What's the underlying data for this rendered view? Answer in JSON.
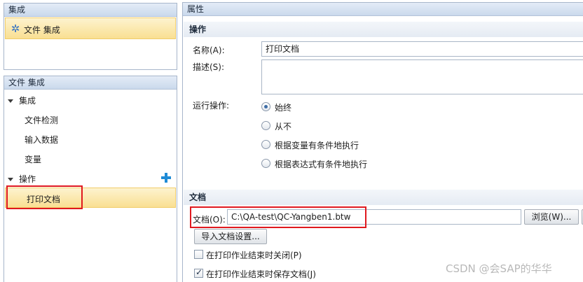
{
  "integration_panel": {
    "title": "集成",
    "item_label": "文件 集成",
    "item_icon": "gear-icon"
  },
  "tree_panel": {
    "title": "文件 集成",
    "groups": [
      {
        "label": "集成",
        "children": [
          "文件检测",
          "输入数据",
          "变量"
        ]
      },
      {
        "label": "操作",
        "children": [
          "打印文档"
        ]
      }
    ],
    "add_icon": "plus-icon",
    "selected": "打印文档"
  },
  "properties": {
    "title": "属性",
    "action_section": {
      "heading": "操作",
      "name_label": "名称(A):",
      "name_value": "打印文档",
      "description_label": "描述(S):",
      "description_value": "",
      "run_label": "运行操作:",
      "run_options": [
        "始终",
        "从不",
        "根据变量有条件地执行",
        "根据表达式有条件地执行"
      ],
      "run_selected": "始终"
    },
    "document_section": {
      "heading": "文档",
      "doc_label": "文档(O):",
      "doc_value": "C:\\QA-test\\QC-Yangben1.btw",
      "browse_button": "浏览(W)...",
      "import_button": "导入文档设置...",
      "close_after_print": {
        "label": "在打印作业结束时关闭(P)",
        "checked": false
      },
      "save_after_print": {
        "label": "在打印作业结束时保存文档(J)",
        "checked": true
      }
    }
  },
  "watermark": "CSDN @会SAP的华华",
  "colors": {
    "highlight": "#e0191f",
    "selection": "#f9df92",
    "accent": "#1f8bd6"
  }
}
